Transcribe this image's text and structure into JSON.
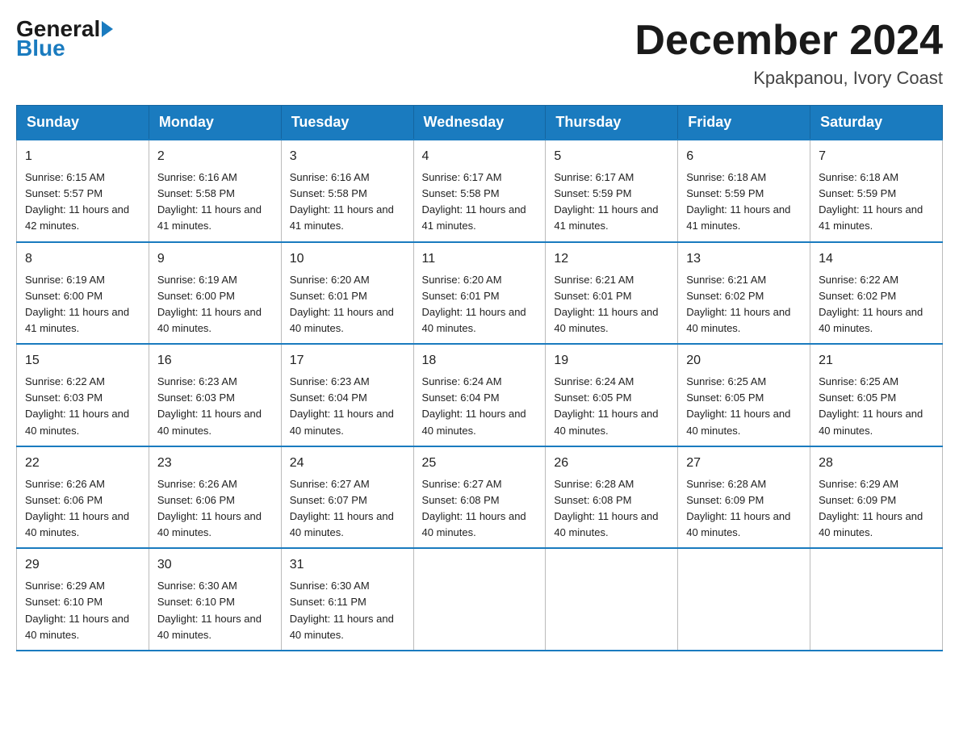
{
  "logo": {
    "general": "General",
    "blue": "Blue"
  },
  "title": {
    "month_year": "December 2024",
    "location": "Kpakpanou, Ivory Coast"
  },
  "weekdays": [
    "Sunday",
    "Monday",
    "Tuesday",
    "Wednesday",
    "Thursday",
    "Friday",
    "Saturday"
  ],
  "weeks": [
    [
      {
        "day": "1",
        "sunrise": "6:15 AM",
        "sunset": "5:57 PM",
        "daylight": "11 hours and 42 minutes."
      },
      {
        "day": "2",
        "sunrise": "6:16 AM",
        "sunset": "5:58 PM",
        "daylight": "11 hours and 41 minutes."
      },
      {
        "day": "3",
        "sunrise": "6:16 AM",
        "sunset": "5:58 PM",
        "daylight": "11 hours and 41 minutes."
      },
      {
        "day": "4",
        "sunrise": "6:17 AM",
        "sunset": "5:58 PM",
        "daylight": "11 hours and 41 minutes."
      },
      {
        "day": "5",
        "sunrise": "6:17 AM",
        "sunset": "5:59 PM",
        "daylight": "11 hours and 41 minutes."
      },
      {
        "day": "6",
        "sunrise": "6:18 AM",
        "sunset": "5:59 PM",
        "daylight": "11 hours and 41 minutes."
      },
      {
        "day": "7",
        "sunrise": "6:18 AM",
        "sunset": "5:59 PM",
        "daylight": "11 hours and 41 minutes."
      }
    ],
    [
      {
        "day": "8",
        "sunrise": "6:19 AM",
        "sunset": "6:00 PM",
        "daylight": "11 hours and 41 minutes."
      },
      {
        "day": "9",
        "sunrise": "6:19 AM",
        "sunset": "6:00 PM",
        "daylight": "11 hours and 40 minutes."
      },
      {
        "day": "10",
        "sunrise": "6:20 AM",
        "sunset": "6:01 PM",
        "daylight": "11 hours and 40 minutes."
      },
      {
        "day": "11",
        "sunrise": "6:20 AM",
        "sunset": "6:01 PM",
        "daylight": "11 hours and 40 minutes."
      },
      {
        "day": "12",
        "sunrise": "6:21 AM",
        "sunset": "6:01 PM",
        "daylight": "11 hours and 40 minutes."
      },
      {
        "day": "13",
        "sunrise": "6:21 AM",
        "sunset": "6:02 PM",
        "daylight": "11 hours and 40 minutes."
      },
      {
        "day": "14",
        "sunrise": "6:22 AM",
        "sunset": "6:02 PM",
        "daylight": "11 hours and 40 minutes."
      }
    ],
    [
      {
        "day": "15",
        "sunrise": "6:22 AM",
        "sunset": "6:03 PM",
        "daylight": "11 hours and 40 minutes."
      },
      {
        "day": "16",
        "sunrise": "6:23 AM",
        "sunset": "6:03 PM",
        "daylight": "11 hours and 40 minutes."
      },
      {
        "day": "17",
        "sunrise": "6:23 AM",
        "sunset": "6:04 PM",
        "daylight": "11 hours and 40 minutes."
      },
      {
        "day": "18",
        "sunrise": "6:24 AM",
        "sunset": "6:04 PM",
        "daylight": "11 hours and 40 minutes."
      },
      {
        "day": "19",
        "sunrise": "6:24 AM",
        "sunset": "6:05 PM",
        "daylight": "11 hours and 40 minutes."
      },
      {
        "day": "20",
        "sunrise": "6:25 AM",
        "sunset": "6:05 PM",
        "daylight": "11 hours and 40 minutes."
      },
      {
        "day": "21",
        "sunrise": "6:25 AM",
        "sunset": "6:05 PM",
        "daylight": "11 hours and 40 minutes."
      }
    ],
    [
      {
        "day": "22",
        "sunrise": "6:26 AM",
        "sunset": "6:06 PM",
        "daylight": "11 hours and 40 minutes."
      },
      {
        "day": "23",
        "sunrise": "6:26 AM",
        "sunset": "6:06 PM",
        "daylight": "11 hours and 40 minutes."
      },
      {
        "day": "24",
        "sunrise": "6:27 AM",
        "sunset": "6:07 PM",
        "daylight": "11 hours and 40 minutes."
      },
      {
        "day": "25",
        "sunrise": "6:27 AM",
        "sunset": "6:08 PM",
        "daylight": "11 hours and 40 minutes."
      },
      {
        "day": "26",
        "sunrise": "6:28 AM",
        "sunset": "6:08 PM",
        "daylight": "11 hours and 40 minutes."
      },
      {
        "day": "27",
        "sunrise": "6:28 AM",
        "sunset": "6:09 PM",
        "daylight": "11 hours and 40 minutes."
      },
      {
        "day": "28",
        "sunrise": "6:29 AM",
        "sunset": "6:09 PM",
        "daylight": "11 hours and 40 minutes."
      }
    ],
    [
      {
        "day": "29",
        "sunrise": "6:29 AM",
        "sunset": "6:10 PM",
        "daylight": "11 hours and 40 minutes."
      },
      {
        "day": "30",
        "sunrise": "6:30 AM",
        "sunset": "6:10 PM",
        "daylight": "11 hours and 40 minutes."
      },
      {
        "day": "31",
        "sunrise": "6:30 AM",
        "sunset": "6:11 PM",
        "daylight": "11 hours and 40 minutes."
      },
      null,
      null,
      null,
      null
    ]
  ]
}
